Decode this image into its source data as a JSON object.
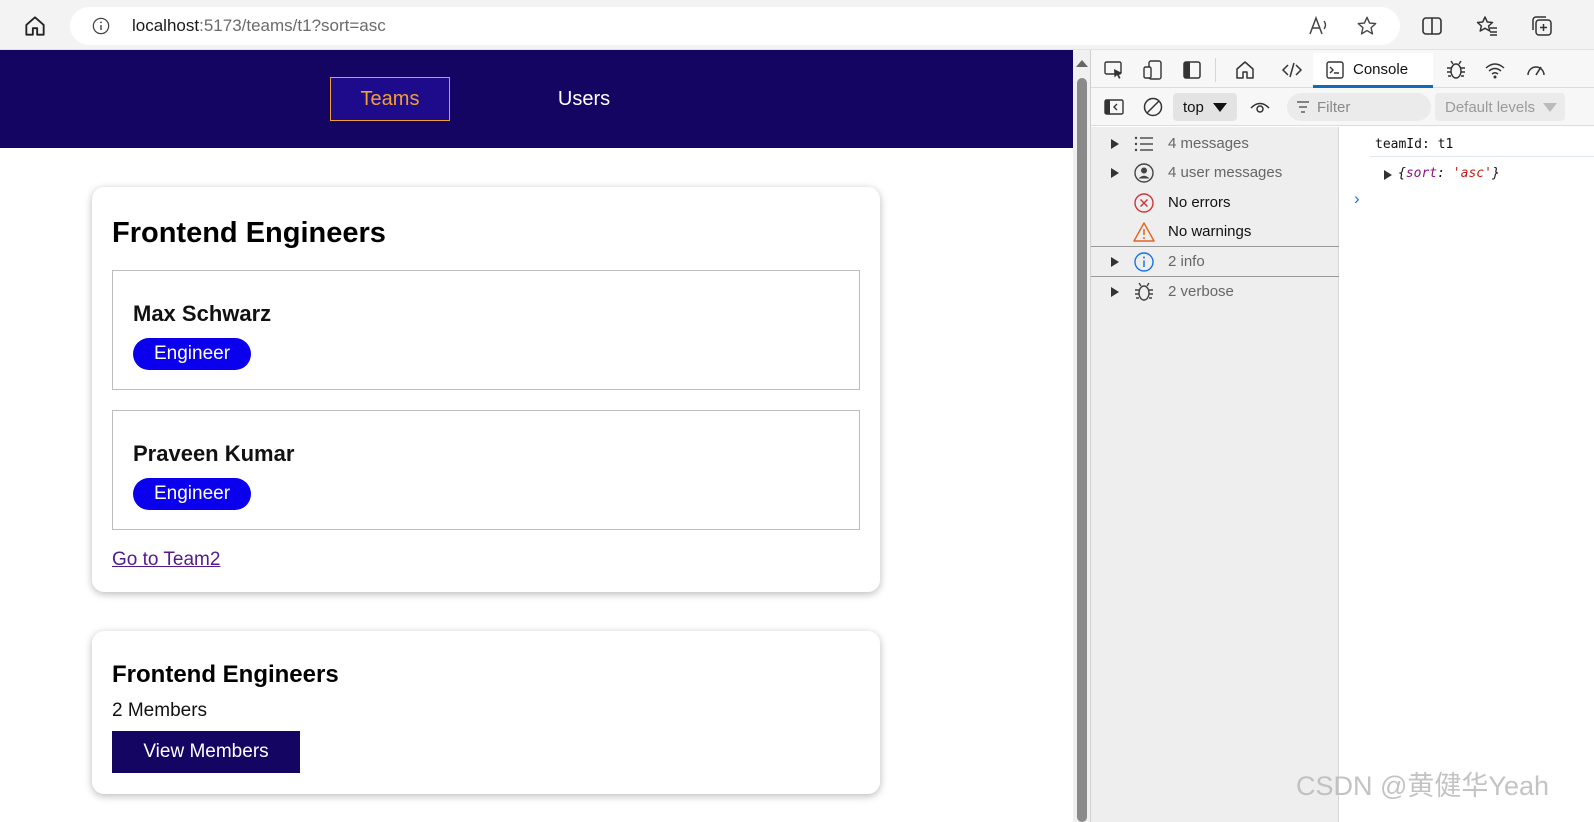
{
  "browser": {
    "url_host": "localhost",
    "url_rest": ":5173/teams/t1?sort=asc"
  },
  "nav": {
    "teams_label": "Teams",
    "users_label": "Users"
  },
  "team_card": {
    "title": "Frontend Engineers",
    "members": [
      {
        "name": "Max Schwarz",
        "role": "Engineer"
      },
      {
        "name": "Praveen Kumar",
        "role": "Engineer"
      }
    ],
    "link_label": "Go to Team2"
  },
  "summary_card": {
    "title": "Frontend Engineers",
    "count": "2 Members",
    "button_label": "View Members"
  },
  "devtools": {
    "console_tab": "Console",
    "context": "top",
    "filter_placeholder": "Filter",
    "levels_label": "Default levels",
    "sidebar": [
      {
        "label": "4 messages",
        "icon": "list-icon",
        "color": "#666666"
      },
      {
        "label": "4 user messages",
        "icon": "user-icon",
        "color": "#666666"
      },
      {
        "label": "No errors",
        "icon": "error-icon",
        "color": "#111111"
      },
      {
        "label": "No warnings",
        "icon": "warning-icon",
        "color": "#111111"
      },
      {
        "label": "2 info",
        "icon": "info-icon",
        "color": "#666666"
      },
      {
        "label": "2 verbose",
        "icon": "bug-icon",
        "color": "#666666"
      }
    ],
    "log_line1": "teamId: t1",
    "log_obj_open": "{",
    "log_obj_key": "sort",
    "log_obj_colon": ": ",
    "log_obj_value": "'asc'",
    "log_obj_close": "}",
    "prompt": "›"
  },
  "watermark": "CSDN @黄健华Yeah",
  "colors": {
    "header_bg": "#140563",
    "active_nav": "#f0a030",
    "badge_bg": "#0a00ee",
    "link": "#551a8b"
  }
}
